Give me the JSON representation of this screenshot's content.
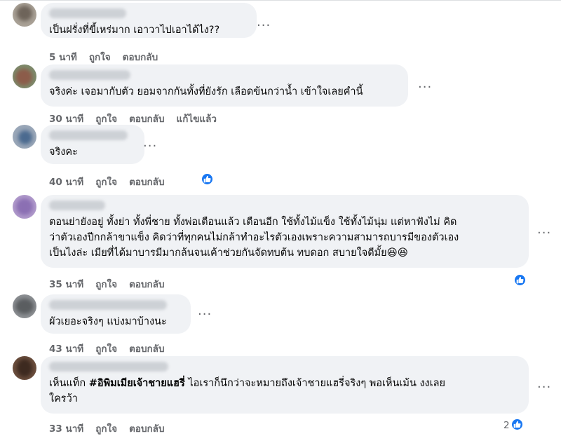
{
  "more_glyph": "···",
  "comments": [
    {
      "text_lines": [
        "เป็นฝรั่งที่ขี้เหร่มาก เอาวาไปเอาได้ไง??"
      ],
      "timestamp": "5 นาที",
      "like_action": "ถูกใจ",
      "reply_action": "ตอบกลับ"
    },
    {
      "text_lines": [
        "จริงค่ะ เจอมากับตัว ยอมจากกันทั้งที่ยังรัก เลือดข้นกว่าน้ำ เข้าใจเลยคำนี้"
      ],
      "timestamp": "30 นาที",
      "like_action": "ถูกใจ",
      "reply_action": "ตอบกลับ",
      "edited_label": "แก้ไขแล้ว"
    },
    {
      "text_lines": [
        "จริงคะ"
      ],
      "timestamp": "40 นาที",
      "like_action": "ถูกใจ",
      "reply_action": "ตอบกลับ",
      "reaction": "like"
    },
    {
      "text_lines": [
        "ตอนย่ายังอยู่ ทั้งย่า ทั้งพี่ชาย ทั้งพ่อเตือนแล้ว เตือนอีก ใช้ทั้งไม้แข็ง ใช้ทั้งไม้นุ่ม แต่หาฟังไม่ คิด",
        "ว่าตัวเองปีกกล้าขาแข็ง คิดว่าที่ทุกคนไม่กล้าทำอะไรตัวเองเพราะความสามารถบารมีของตัวเอง",
        "เป็นไงล่ะ เมียที่ได้มาบารมีมากล้นจนเค้าช่วยกันจัดทบต้น ทบดอก สบายใจดีมั้ย😆😆"
      ],
      "timestamp": "35 นาที",
      "like_action": "ถูกใจ",
      "reply_action": "ตอบกลับ",
      "reaction": "like"
    },
    {
      "text_lines": [
        "ผัวเยอะจริงๆ แบ่งมาบ้างนะ"
      ],
      "timestamp": "43 นาที",
      "like_action": "ถูกใจ",
      "reply_action": "ตอบกลับ"
    },
    {
      "text_prefix": "เห็นแท็ก ",
      "hashtag": "#อิพิมเมียเจ้าชายแฮรี่",
      "text_suffix": " ไอเราก็นึกว่าจะหมายถึงเจ้าชายแฮรี่จริงๆ พอเห็นเม้น งงเลย",
      "text_line2": "ใครว้า",
      "timestamp": "33 นาที",
      "like_action": "ถูกใจ",
      "reply_action": "ตอบกลับ",
      "reaction": "like",
      "reaction_count": "2"
    }
  ],
  "colors": {
    "bubble": "#f0f2f5",
    "meta_text": "#65676b",
    "like_blue": "#1877f2"
  }
}
